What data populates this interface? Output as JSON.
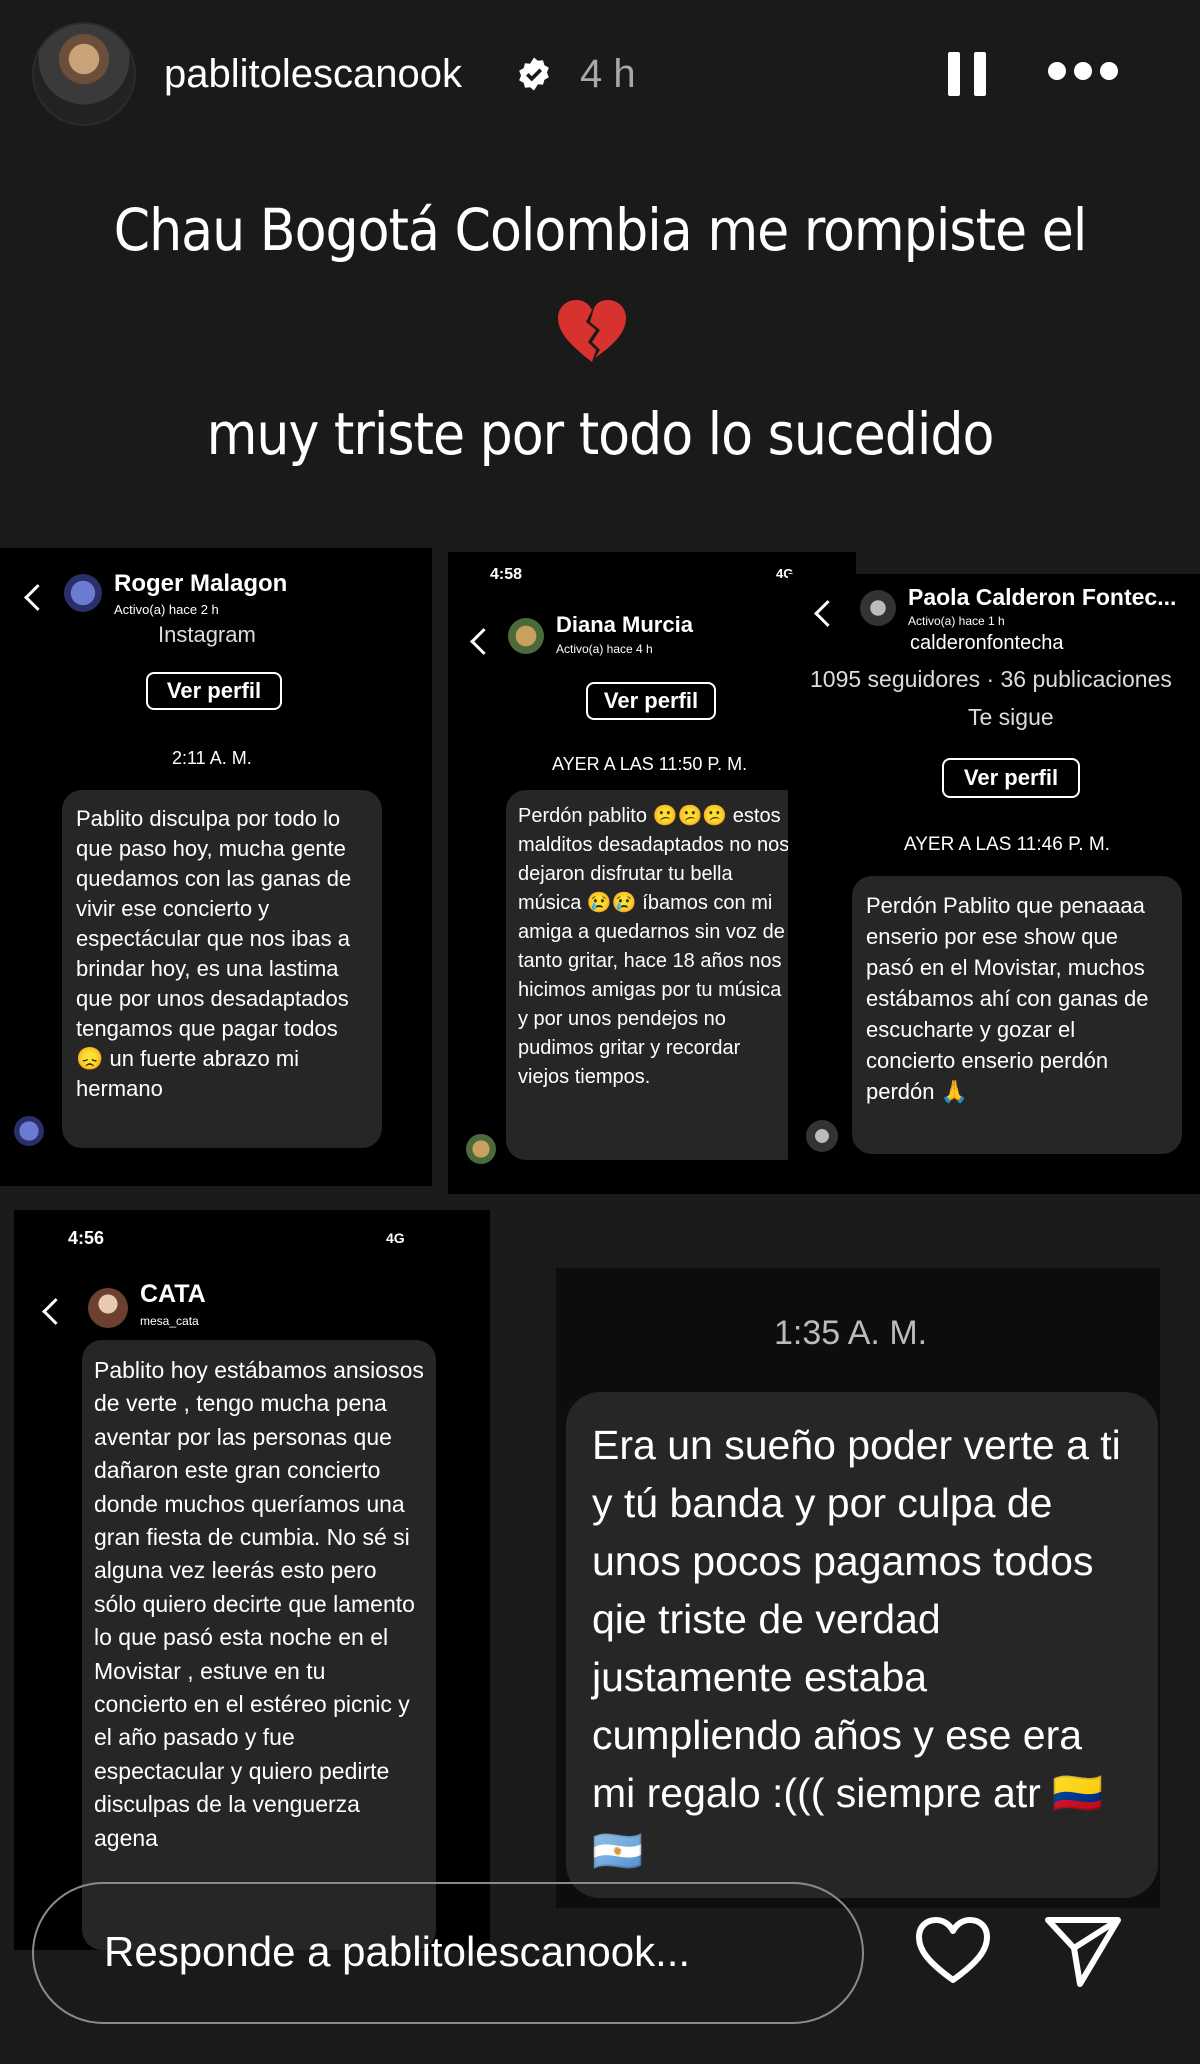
{
  "header": {
    "username": "pablitolescanook",
    "time": "4 h",
    "icons": [
      "verified-badge-icon",
      "pause-icon",
      "more-icon"
    ]
  },
  "caption": {
    "line1": "Chau Bogotá Colombia me rompiste el",
    "emoji": "broken-heart-icon",
    "line2": "muy triste por todo lo sucedido"
  },
  "card1": {
    "name": "Roger Malagon",
    "status": "Activo(a) hace 2 h",
    "sub": "Instagram",
    "profile_btn": "Ver perfil",
    "timestamp": "2:11 A. M.",
    "message": "Pablito disculpa por todo lo que paso hoy, mucha gente quedamos con las ganas de vivir ese concierto y espectácular que nos ibas a brindar hoy, es una lastima que por unos desadaptados tengamos que pagar todos 😞 un fuerte abrazo mi hermano"
  },
  "card2": {
    "clock": "4:58",
    "signal": "4G",
    "name": "Diana Murcia",
    "status": "Activo(a) hace 4 h",
    "profile_btn": "Ver perfil",
    "timestamp": "AYER A LAS 11:50 P. M.",
    "message": "Perdón pablito 😕😕😕 estos malditos desadaptados no nos dejaron disfrutar tu bella música 😢😢 íbamos con mi amiga a quedarnos sin voz de tanto gritar, hace 18 años nos hicimos amigas por tu música y por unos pendejos no pudimos gritar y recordar viejos tiempos."
  },
  "card3": {
    "name": "Paola Calderon Fontec...",
    "status": "Activo(a) hace 1 h",
    "handle": "calderonfontecha",
    "stats": "1095 seguidores · 36 publicaciones",
    "follows": "Te sigue",
    "profile_btn": "Ver perfil",
    "timestamp": "AYER A LAS 11:46 P. M.",
    "message": "Perdón Pablito que penaaaa enserio por ese show que pasó en el Movistar, muchos estábamos ahí con ganas de escucharte y gozar el concierto enserio perdón perdón 🙏"
  },
  "card4": {
    "clock": "4:56",
    "signal": "4G",
    "name": "CATA",
    "handle": "mesa_cata",
    "message": "Pablito hoy estábamos ansiosos de verte , tengo mucha pena aventar por las personas que dañaron este gran concierto donde muchos queríamos una gran fiesta de cumbia. No sé si alguna vez leerás esto pero sólo quiero decirte que lamento lo que pasó esta noche en el Movistar , estuve en tu concierto en el estéreo picnic y el año pasado y fue espectacular y quiero pedirte disculpas de la venguerza agena"
  },
  "card5": {
    "timestamp": "1:35 A. M.",
    "message": "Era un sueño poder verte a ti y tú banda y por culpa de unos pocos pagamos todos qie triste de verdad justamente estaba cumpliendo años y ese era mi regalo :((( siempre atr 🇨🇴 🇦🇷"
  },
  "reply": {
    "placeholder": "Responde a pablitolescanook..."
  },
  "colors": {
    "background": "#1a1a1a",
    "bubble": "#262626",
    "card": "#000000"
  }
}
